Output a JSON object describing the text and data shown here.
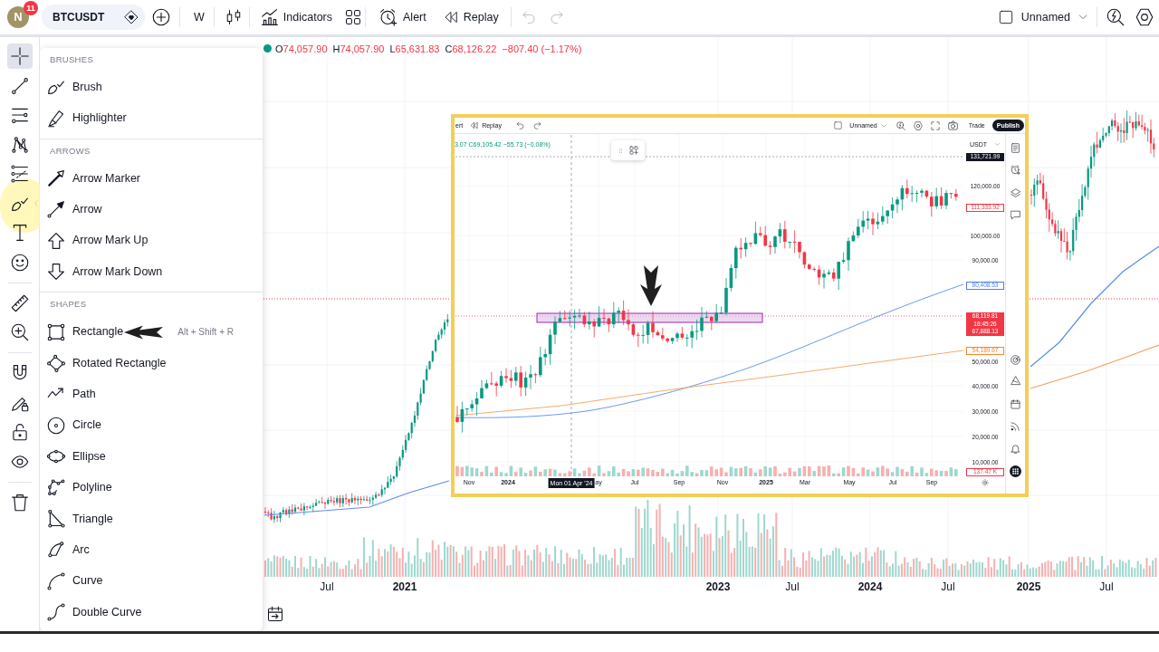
{
  "top_toolbar": {
    "avatar": {
      "initial": "N",
      "badge": "11"
    },
    "symbol": "BTCUSDT",
    "interval": "W",
    "items": [
      {
        "kind": "indicators",
        "label": "Indicators"
      },
      {
        "kind": "alert",
        "label": "Alert"
      },
      {
        "kind": "replay",
        "label": "Replay"
      }
    ],
    "undo": {
      "disabled": true
    },
    "redo": {
      "disabled": true
    },
    "layout_name": "Unnamed"
  },
  "drawing_toolbar": {
    "groups": [
      {
        "tools": [
          {
            "kind": "crosshair",
            "selected": true,
            "expanded": false
          },
          {
            "kind": "trend-line",
            "selected": false,
            "expanded": false
          },
          {
            "kind": "parallel-lines",
            "selected": false,
            "expanded": false
          },
          {
            "kind": "pattern",
            "selected": false,
            "expanded": false
          },
          {
            "kind": "projection",
            "selected": false,
            "expanded": false
          },
          {
            "kind": "brush",
            "selected": false,
            "expanded": true
          },
          {
            "kind": "text",
            "selected": false,
            "expanded": false
          },
          {
            "kind": "emoji",
            "selected": false,
            "expanded": false
          }
        ]
      },
      {
        "tools": [
          {
            "kind": "ruler",
            "selected": false,
            "expanded": false
          },
          {
            "kind": "zoom",
            "selected": false,
            "expanded": false
          }
        ]
      },
      {
        "tools": [
          {
            "kind": "magnet",
            "selected": false,
            "expanded": false
          },
          {
            "kind": "drawing-lock",
            "selected": false,
            "expanded": false
          },
          {
            "kind": "lock",
            "selected": false,
            "expanded": false
          },
          {
            "kind": "visibility",
            "selected": false,
            "expanded": false
          }
        ]
      },
      {
        "tools": [
          {
            "kind": "delete",
            "selected": false,
            "expanded": false
          }
        ]
      }
    ]
  },
  "tool_menu": {
    "sections": [
      {
        "title": "BRUSHES",
        "items": [
          {
            "kind": "brush",
            "label": "Brush"
          },
          {
            "kind": "highlighter",
            "label": "Highlighter"
          }
        ]
      },
      {
        "title": "ARROWS",
        "items": [
          {
            "kind": "arrow-marker",
            "label": "Arrow Marker"
          },
          {
            "kind": "arrow",
            "label": "Arrow"
          },
          {
            "kind": "arrow-up",
            "label": "Arrow Mark Up"
          },
          {
            "kind": "arrow-down",
            "label": "Arrow Mark Down"
          }
        ]
      },
      {
        "title": "SHAPES",
        "items": [
          {
            "kind": "rectangle",
            "label": "Rectangle",
            "shortcut": "Alt + Shift + R"
          },
          {
            "kind": "rotated-rectangle",
            "label": "Rotated Rectangle"
          },
          {
            "kind": "path",
            "label": "Path"
          },
          {
            "kind": "circle",
            "label": "Circle"
          },
          {
            "kind": "ellipse",
            "label": "Ellipse"
          },
          {
            "kind": "polyline",
            "label": "Polyline"
          },
          {
            "kind": "triangle",
            "label": "Triangle"
          },
          {
            "kind": "arc",
            "label": "Arc"
          },
          {
            "kind": "curve",
            "label": "Curve"
          },
          {
            "kind": "double-curve",
            "label": "Double Curve"
          }
        ]
      }
    ]
  },
  "chart": {
    "legend": {
      "ohlc": [
        {
          "letter": "O",
          "value": "74,057.90"
        },
        {
          "letter": "H",
          "value": "74,057.90"
        },
        {
          "letter": "L",
          "value": "65,631.83"
        },
        {
          "letter": "C",
          "value": "68,126.22"
        }
      ],
      "change": "−807.40 (−1.17%)"
    },
    "time_axis": [
      {
        "label": "Jul",
        "kind": "month"
      },
      {
        "label": "2021",
        "kind": "year"
      },
      {
        "label": "2023",
        "kind": "year"
      },
      {
        "label": "Jul",
        "kind": "month"
      },
      {
        "label": "2024",
        "kind": "year"
      },
      {
        "label": "Jul",
        "kind": "month"
      },
      {
        "label": "2025",
        "kind": "year"
      },
      {
        "label": "Jul",
        "kind": "month"
      }
    ]
  },
  "inset_screenshot": {
    "top_bar": {
      "clipped_label": "ert",
      "replay_label": "Replay",
      "layout_name": "Unnamed",
      "trade_label": "Trade",
      "publish_label": "Publish"
    },
    "legend": "3.07 C69,105.42 −55.73 (−0.08%)",
    "currency": "USDT",
    "price_ticks": [
      "120,000.00",
      "100,000.00",
      "90,000.00",
      "50,000.00",
      "40,000.00",
      "30,000.00",
      "20,000.00",
      "10,000.00"
    ],
    "price_tags": [
      {
        "text": "131,721.99",
        "color": "#131722",
        "kind": "filled"
      },
      {
        "text": "111,333.92",
        "color": "#f23645",
        "kind": "outlined"
      },
      {
        "text": "80,408.53",
        "color": "#4f7ff0",
        "kind": "outlined"
      },
      {
        "text": "68,119.81",
        "color": "#f23645",
        "kind": "filled"
      },
      {
        "text": "18:45:26",
        "color": "#f23645",
        "kind": "filled"
      },
      {
        "text": "67,888.13",
        "color": "#f23645",
        "kind": "filled"
      },
      {
        "text": "54,189.67",
        "color": "#f5872f",
        "kind": "outlined"
      },
      {
        "text": "137.47 K",
        "color": "#f23645",
        "kind": "outlined"
      }
    ],
    "crosshair_date": "Mon 01 Apr '24",
    "time_axis": [
      {
        "label": "Nov",
        "kind": "month"
      },
      {
        "label": "2024",
        "kind": "year"
      },
      {
        "label": "ay",
        "kind": "month"
      },
      {
        "label": "Jul",
        "kind": "month"
      },
      {
        "label": "Sep",
        "kind": "month"
      },
      {
        "label": "Nov",
        "kind": "month"
      },
      {
        "label": "2025",
        "kind": "year"
      },
      {
        "label": "Mar",
        "kind": "month"
      },
      {
        "label": "May",
        "kind": "month"
      },
      {
        "label": "Jul",
        "kind": "month"
      },
      {
        "label": "Sep",
        "kind": "month"
      }
    ]
  }
}
